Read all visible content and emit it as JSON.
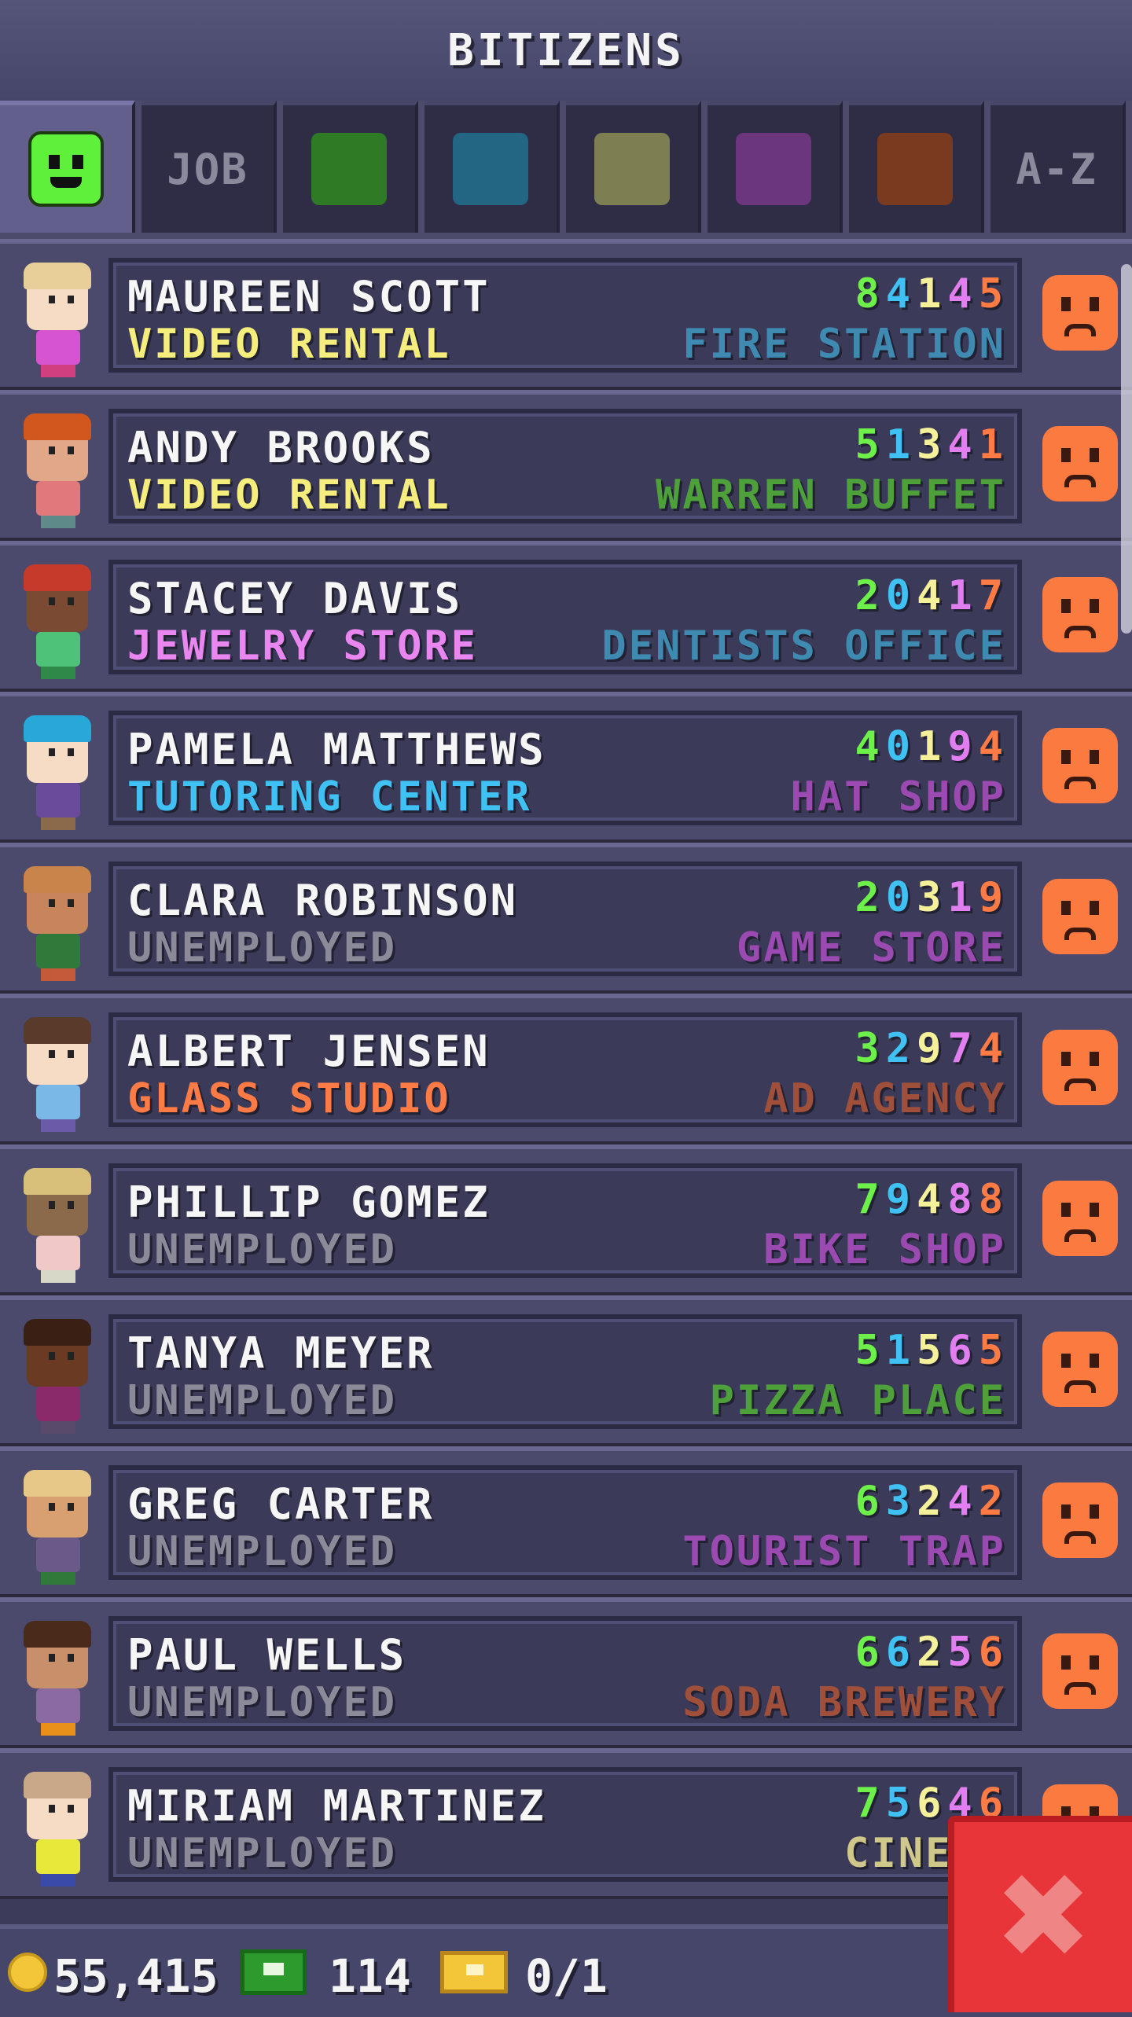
{
  "header": {
    "title": "BITIZENS"
  },
  "tabs": [
    {
      "type": "smiley",
      "icon": "happy-face-icon",
      "active": true
    },
    {
      "type": "text",
      "label": "JOB"
    },
    {
      "type": "swatch",
      "color": "#2f7a24"
    },
    {
      "type": "swatch",
      "color": "#236683"
    },
    {
      "type": "swatch",
      "color": "#7d7f52"
    },
    {
      "type": "swatch",
      "color": "#6c367e"
    },
    {
      "type": "swatch",
      "color": "#7a3a1f"
    },
    {
      "type": "text",
      "label": "A-Z"
    }
  ],
  "bitizens": [
    {
      "name": "MAUREEN SCOTT",
      "job": "VIDEO RENTAL",
      "job_color": "#f5ee7c",
      "skills": [
        "8",
        "4",
        "1",
        "4",
        "5"
      ],
      "dream": "FIRE STATION",
      "dream_color": "#3f8ab0",
      "skin": "#f6dcc4",
      "hair": "#e8cf9a",
      "shirt": "#d654d0",
      "legs": "#d04080"
    },
    {
      "name": "ANDY BROOKS",
      "job": "VIDEO RENTAL",
      "job_color": "#f5ee7c",
      "skills": [
        "5",
        "1",
        "3",
        "4",
        "1"
      ],
      "dream": "WARREN BUFFET",
      "dream_color": "#4ea03a",
      "skin": "#e0a888",
      "hair": "#d2571c",
      "shirt": "#e0787c",
      "legs": "#5e8a8a"
    },
    {
      "name": "STACEY DAVIS",
      "job": "JEWELRY STORE",
      "job_color": "#e986f0",
      "skills": [
        "2",
        "0",
        "4",
        "1",
        "7"
      ],
      "dream": "DENTISTS OFFICE",
      "dream_color": "#3f8ab0",
      "skin": "#7a4a32",
      "hair": "#c63a2c",
      "shirt": "#4fc27a",
      "legs": "#2f8a4a"
    },
    {
      "name": "PAMELA MATTHEWS",
      "job": "TUTORING CENTER",
      "job_color": "#3fc2f3",
      "skills": [
        "4",
        "0",
        "1",
        "9",
        "4"
      ],
      "dream": "HAT SHOP",
      "dream_color": "#9a4ab0",
      "skin": "#f6dcc4",
      "hair": "#28a8d8",
      "shirt": "#6a4a9a",
      "legs": "#8a6a4a"
    },
    {
      "name": "CLARA ROBINSON",
      "job": "UNEMPLOYED",
      "job_color": "#8a8a98",
      "skills": [
        "2",
        "0",
        "3",
        "1",
        "9"
      ],
      "dream": "GAME STORE",
      "dream_color": "#9a4ab0",
      "skin": "#c8845a",
      "hair": "#c8844a",
      "shirt": "#2f7a3a",
      "legs": "#c45a3a"
    },
    {
      "name": "ALBERT JENSEN",
      "job": "GLASS STUDIO",
      "job_color": "#ff7b45",
      "skills": [
        "3",
        "2",
        "9",
        "7",
        "4"
      ],
      "dream": "AD AGENCY",
      "dream_color": "#a0503a",
      "skin": "#f6dcc4",
      "hair": "#5a3a2a",
      "shirt": "#7ab8e8",
      "legs": "#6a5aa8"
    },
    {
      "name": "PHILLIP GOMEZ",
      "job": "UNEMPLOYED",
      "job_color": "#8a8a98",
      "skills": [
        "7",
        "9",
        "4",
        "8",
        "8"
      ],
      "dream": "BIKE SHOP",
      "dream_color": "#9a4ab0",
      "skin": "#8a6a4a",
      "hair": "#d8c07a",
      "shirt": "#f0c8c8",
      "legs": "#d8d8c8"
    },
    {
      "name": "TANYA MEYER",
      "job": "UNEMPLOYED",
      "job_color": "#8a8a98",
      "skills": [
        "5",
        "1",
        "5",
        "6",
        "5"
      ],
      "dream": "PIZZA PLACE",
      "dream_color": "#4ea03a",
      "skin": "#6a3a22",
      "hair": "#3a2014",
      "shirt": "#8a2a6a",
      "legs": "#5a4a6a"
    },
    {
      "name": "GREG CARTER",
      "job": "UNEMPLOYED",
      "job_color": "#8a8a98",
      "skills": [
        "6",
        "3",
        "2",
        "4",
        "2"
      ],
      "dream": "TOURIST TRAP",
      "dream_color": "#9a4ab0",
      "skin": "#d8a070",
      "hair": "#e8c888",
      "shirt": "#6a5a8a",
      "legs": "#2f7a3a"
    },
    {
      "name": "PAUL WELLS",
      "job": "UNEMPLOYED",
      "job_color": "#8a8a98",
      "skills": [
        "6",
        "6",
        "2",
        "5",
        "6"
      ],
      "dream": "SODA BREWERY",
      "dream_color": "#a0503a",
      "skin": "#c8906a",
      "hair": "#4a2a1a",
      "shirt": "#8a6aa0",
      "legs": "#e8901a"
    },
    {
      "name": "MIRIAM MARTINEZ",
      "job": "UNEMPLOYED",
      "job_color": "#8a8a98",
      "skills": [
        "7",
        "5",
        "6",
        "4",
        "6"
      ],
      "dream": "CINEPL",
      "dream_color": "#d0c88a",
      "skin": "#f6dcc4",
      "hair": "#c8a888",
      "shirt": "#e8e83a",
      "legs": "#3a4aa8"
    }
  ],
  "footer": {
    "coins": "55,415",
    "bux": "114",
    "vip": "0/1",
    "coin_icon": "coin-icon",
    "bux_icon": "bitbux-icon",
    "vip_icon": "vip-ticket-icon"
  },
  "close_button": {
    "icon": "close-icon",
    "color": "#e7353a"
  }
}
